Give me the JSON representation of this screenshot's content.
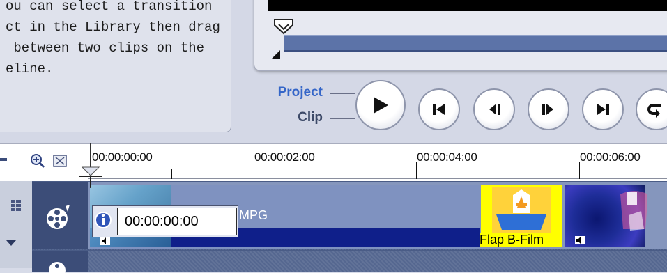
{
  "help_panel": {
    "text": "ou can select a transition\nct in the Library then drag\n between two clips on the\neline."
  },
  "playback": {
    "mode_project": "Project",
    "mode_clip": "Clip",
    "buttons": [
      "play-icon",
      "home-icon",
      "previous-frame-icon",
      "next-frame-icon",
      "end-icon",
      "repeat-icon"
    ]
  },
  "timeline": {
    "ticks": [
      "00:00:00:00",
      "00:00:02:00",
      "00:00:04:00",
      "00:00:06:00"
    ]
  },
  "tracks": {
    "video_clip_name": "MPG",
    "transition_name": "Flap B-Film"
  },
  "tooltip": {
    "time": "00:00:00:00"
  },
  "colors": {
    "accent": "#3566c8",
    "track": "#4a5c86",
    "clip_bar": "#0f1f8a",
    "transition": "#ffff00"
  }
}
